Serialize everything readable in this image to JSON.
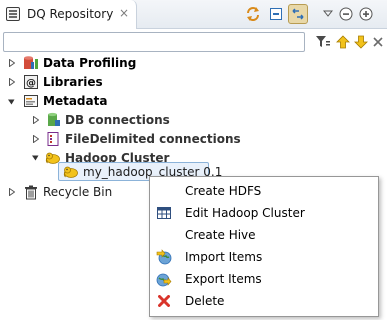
{
  "view": {
    "tab_title": "DQ Repository",
    "tab_close": "×"
  },
  "header_tools": [
    {
      "name": "sync-icon"
    },
    {
      "name": "collapse-all-icon"
    },
    {
      "name": "link-with-editor-icon",
      "active": true
    },
    {
      "name": "view-menu-icon"
    },
    {
      "name": "minimize-icon"
    },
    {
      "name": "maximize-icon"
    }
  ],
  "filter": {
    "value": "",
    "placeholder": ""
  },
  "filter_tools": [
    {
      "name": "filter-icon"
    },
    {
      "name": "arrow-up-icon"
    },
    {
      "name": "arrow-down-icon"
    },
    {
      "name": "close-icon"
    }
  ],
  "tree": {
    "data_profiling": "Data Profiling",
    "libraries": "Libraries",
    "metadata": "Metadata",
    "db_connections": "DB connections",
    "file_delimited": "FileDelimited connections",
    "hadoop_cluster": "Hadoop Cluster",
    "my_cluster": "my_hadoop_cluster 0.1",
    "recycle_bin": "Recycle Bin"
  },
  "context_menu": {
    "items": [
      {
        "label": "Create HDFS",
        "icon": ""
      },
      {
        "label": "Edit Hadoop Cluster",
        "icon": "table-icon"
      },
      {
        "label": "Create Hive",
        "icon": ""
      },
      {
        "label": "Import Items",
        "icon": "import-icon"
      },
      {
        "label": "Export Items",
        "icon": "export-icon"
      },
      {
        "label": "Delete",
        "icon": "delete-icon"
      }
    ]
  },
  "colors": {
    "accent_blue": "#2f6fb5",
    "selection_border": "#8cb3d9",
    "hadoop_yellow": "#f2c21b",
    "delete_red": "#d9342b"
  }
}
